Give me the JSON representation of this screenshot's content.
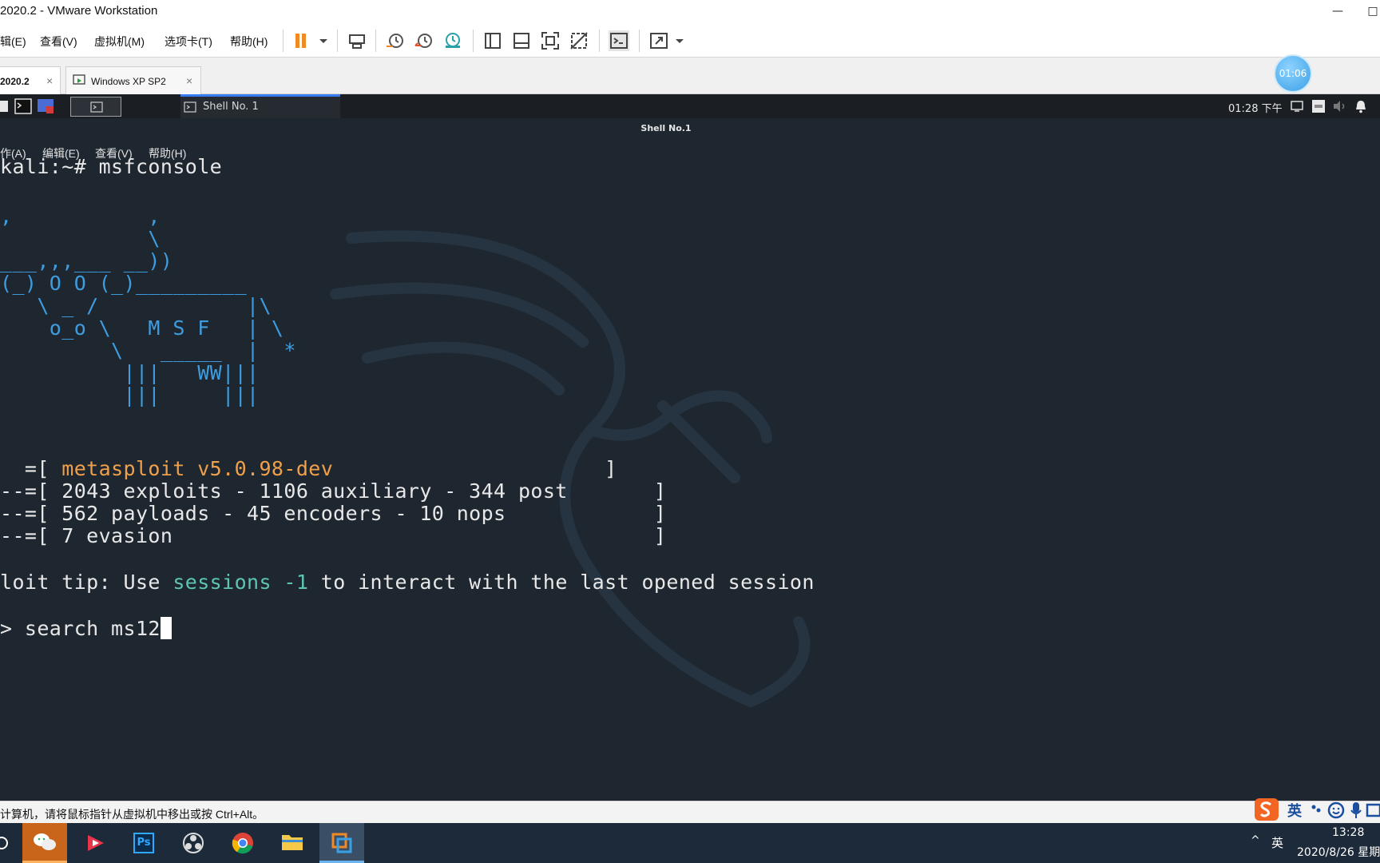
{
  "window": {
    "title": "2020.2 - VMware Workstation",
    "minimize_glyph": "—",
    "maximize_glyph": "□"
  },
  "menu": {
    "items": [
      "辑(E)",
      "查看(V)",
      "虚拟机(M)",
      "选项卡(T)",
      "帮助(H)"
    ]
  },
  "toolbar": {
    "icons": [
      "pause-icon",
      "dropdown-icon",
      "send-ctrl-alt-del-icon",
      "snapshot-icon",
      "revert-snapshot-icon",
      "snapshot-manager-icon",
      "show-library-icon",
      "show-thumbnail-icon",
      "fullscreen-icon",
      "unity-icon",
      "console-view-icon",
      "stretch-icon"
    ]
  },
  "tabs": [
    {
      "label": "2020.2",
      "active": true,
      "close": "×"
    },
    {
      "label": "Windows XP SP2",
      "active": false,
      "close": "×"
    }
  ],
  "timer_badge": "01:06",
  "kali_panel": {
    "task_label": "Shell No. 1",
    "clock": "01:28 下午"
  },
  "terminal": {
    "window_title": "Shell No.1",
    "menu": [
      "作(A)",
      "编辑(E)",
      "查看(V)",
      "帮助(H)"
    ],
    "prompt_line": "kali:~# msfconsole",
    "ascii_art": [
      ",           ,",
      "            \\",
      "___,,,___ __))",
      "(_) O O (_)_________",
      "   \\ _ /            |\\",
      "    o_o \\   M S F   | \\",
      "         \\   _____  |  *",
      "          |||   WW|||",
      "          |||     |||"
    ],
    "banner": {
      "line1_prefix": "  =[ ",
      "version": "metasploit v5.0.98-dev",
      "line1_suffix": "                      ]",
      "line2": "--=[ 2043 exploits - 1106 auxiliary - 344 post       ]",
      "line3": "--=[ 562 payloads - 45 encoders - 10 nops            ]",
      "line4": "--=[ 7 evasion                                       ]"
    },
    "tip_prefix": "loit tip: Use ",
    "tip_command": "sessions -1",
    "tip_suffix": " to interact with the last opened session",
    "command_line": "> search ms12"
  },
  "status": {
    "message": "计算机，请将鼠标指针从虚拟机中移出或按 Ctrl+Alt。",
    "ime_label": "英"
  },
  "taskbar": {
    "apps": [
      "wechat-icon",
      "media-player-icon",
      "photoshop-icon",
      "obs-icon",
      "chrome-icon",
      "file-explorer-icon",
      "vmware-icon"
    ],
    "ps_label": "Ps",
    "tray_lang": "英",
    "tray_up": "^",
    "time": "13:28",
    "date": "2020/8/26 星期"
  }
}
